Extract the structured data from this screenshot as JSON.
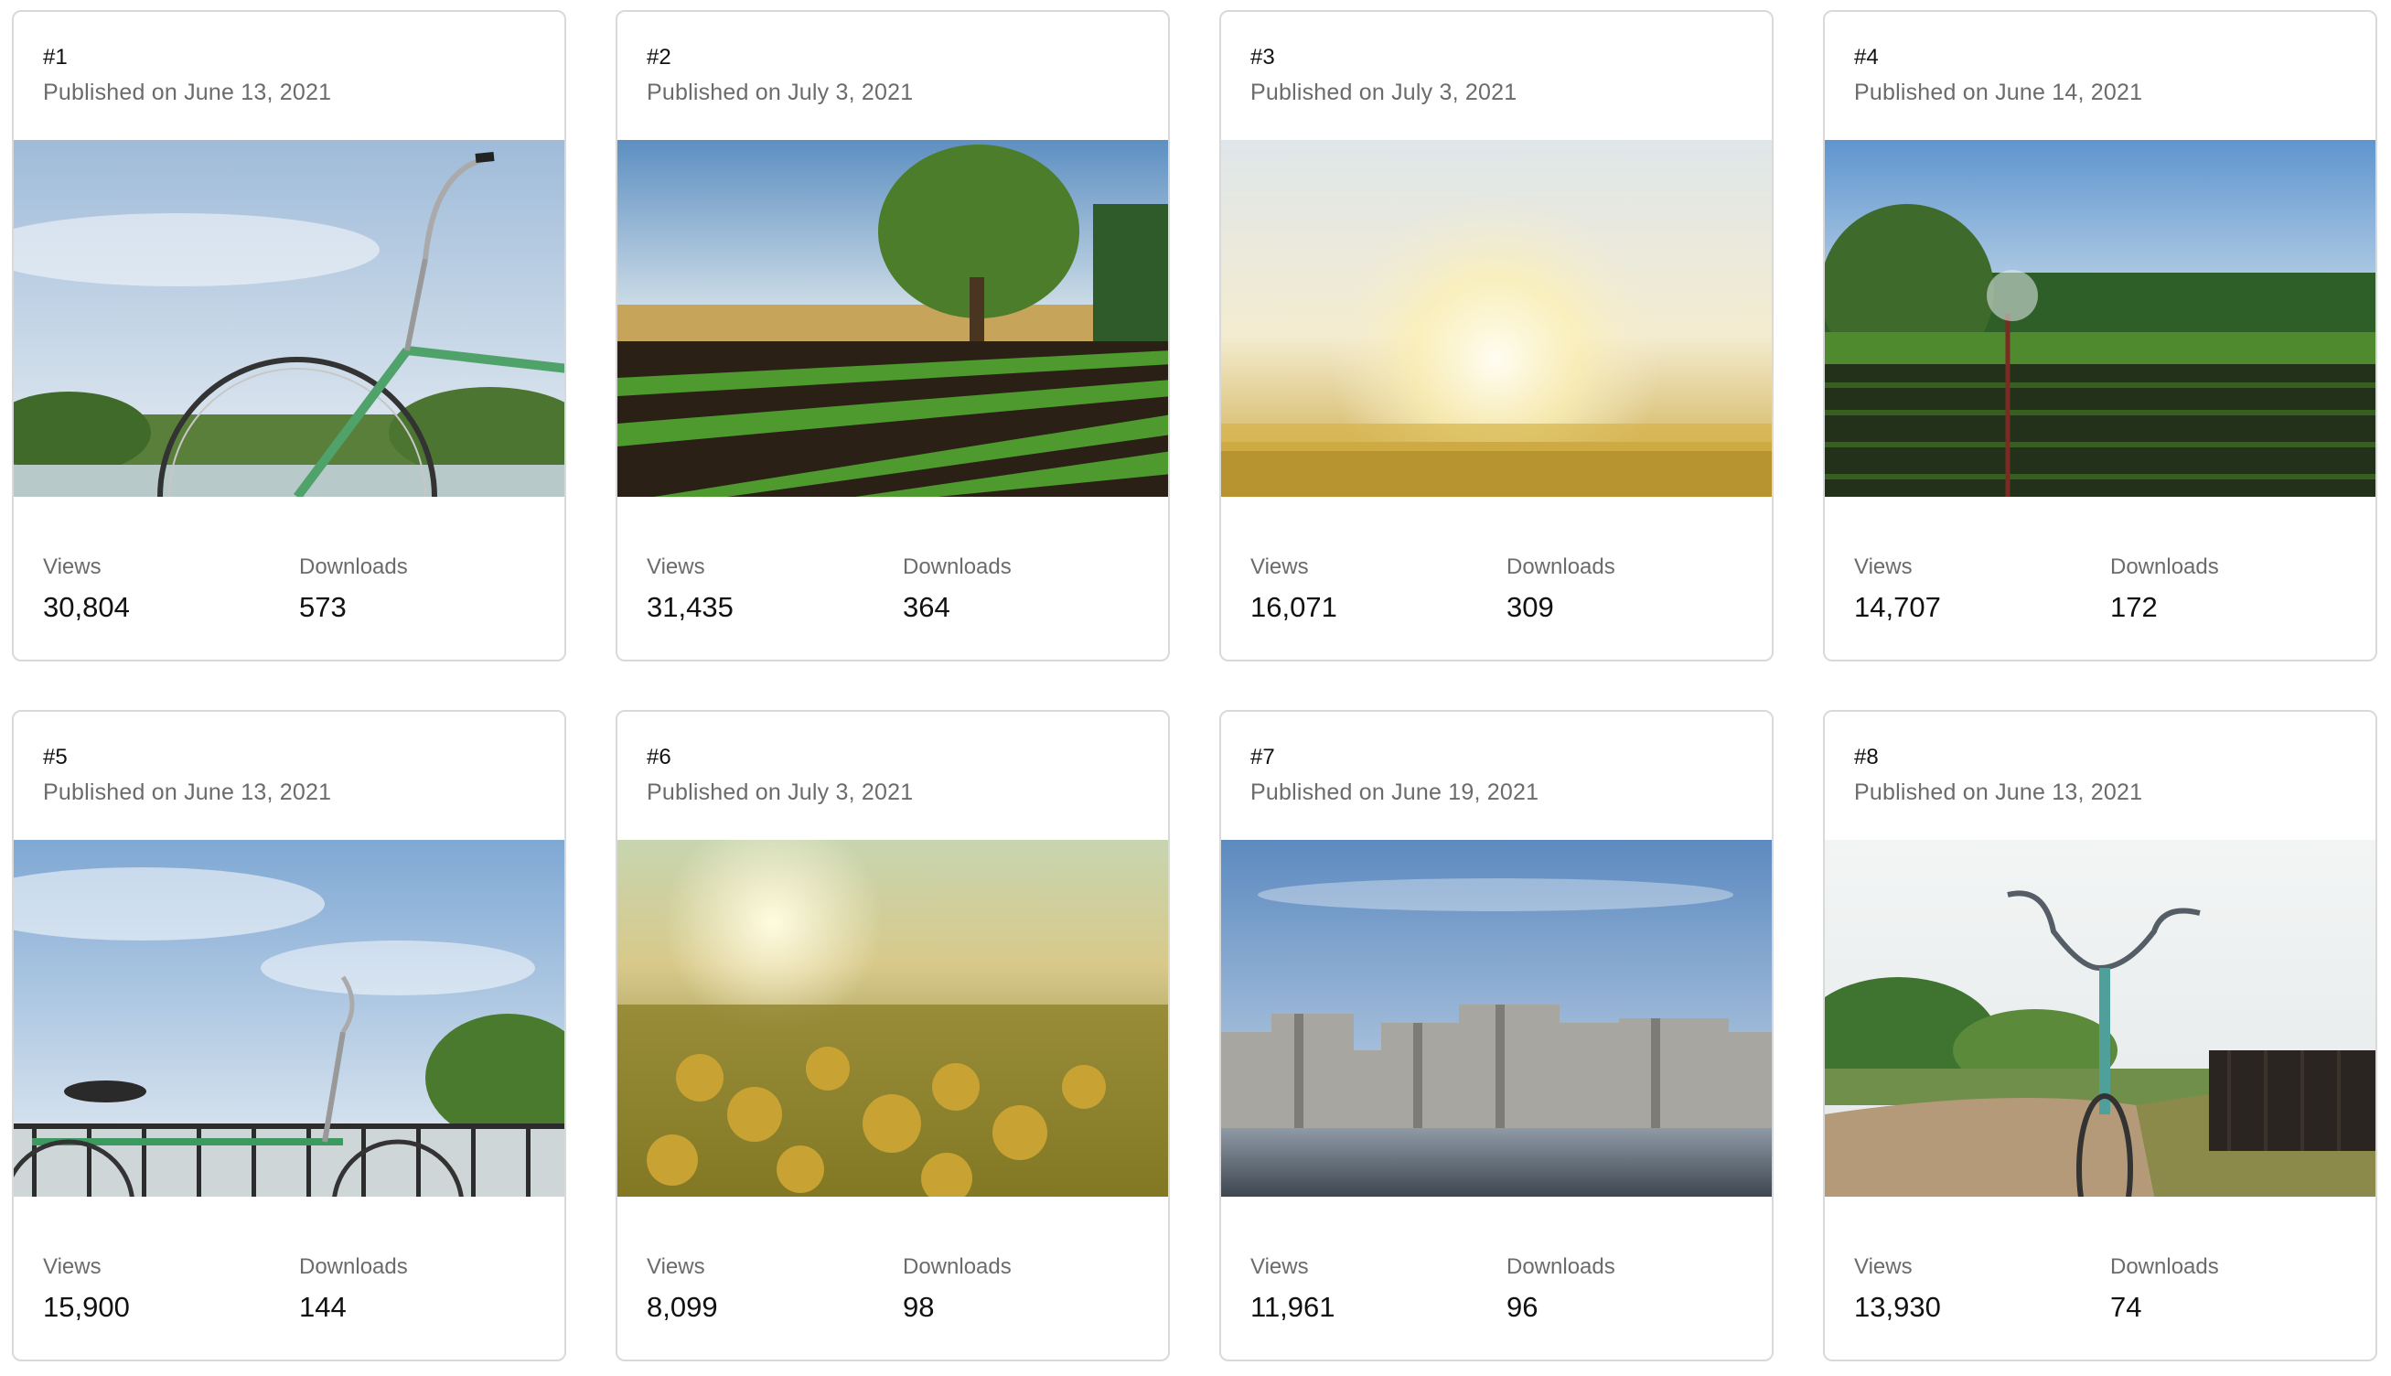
{
  "stat_labels": {
    "views": "Views",
    "downloads": "Downloads"
  },
  "cards": [
    {
      "rank": "#1",
      "published": "Published on June 13, 2021",
      "image": "bicycle-by-lake-photo",
      "views": "30,804",
      "downloads": "573"
    },
    {
      "rank": "#2",
      "published": "Published on July 3, 2021",
      "image": "tree-and-crop-rows-photo",
      "views": "31,435",
      "downloads": "364"
    },
    {
      "rank": "#3",
      "published": "Published on July 3, 2021",
      "image": "sunset-over-field-photo",
      "views": "16,071",
      "downloads": "309"
    },
    {
      "rank": "#4",
      "published": "Published on June 14, 2021",
      "image": "field-sprinkler-photo",
      "views": "14,707",
      "downloads": "172"
    },
    {
      "rank": "#5",
      "published": "Published on June 13, 2021",
      "image": "bicycle-at-railing-photo",
      "views": "15,900",
      "downloads": "144"
    },
    {
      "rank": "#6",
      "published": "Published on July 3, 2021",
      "image": "yellow-wildflowers-photo",
      "views": "8,099",
      "downloads": "98"
    },
    {
      "rank": "#7",
      "published": "Published on June 19, 2021",
      "image": "dam-ruins-photo",
      "views": "11,961",
      "downloads": "96"
    },
    {
      "rank": "#8",
      "published": "Published on June 13, 2021",
      "image": "bicycle-on-road-photo",
      "views": "13,930",
      "downloads": "74"
    }
  ]
}
